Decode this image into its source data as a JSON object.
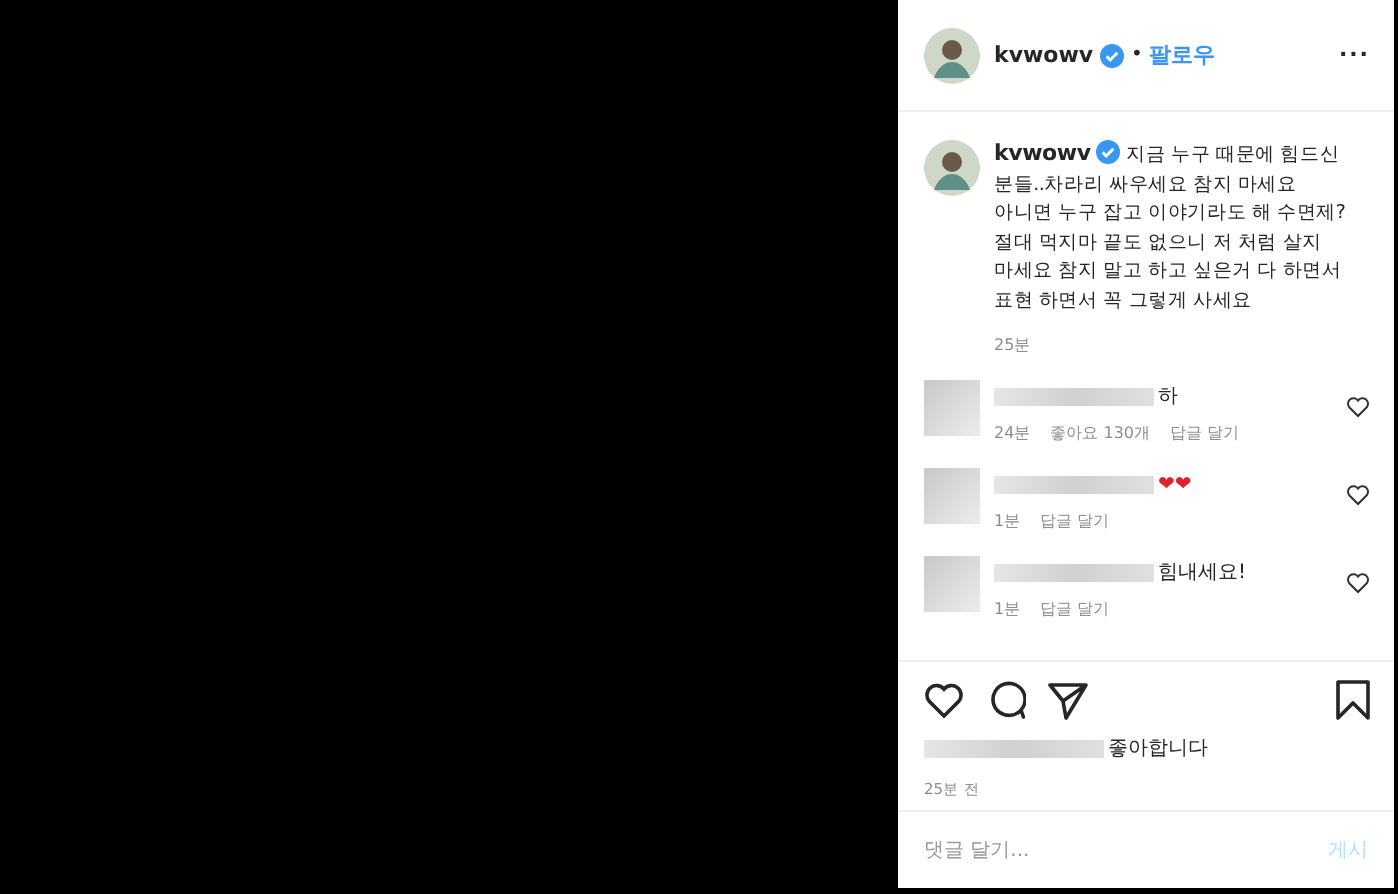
{
  "header": {
    "username": "kvwowv",
    "separator": "•",
    "follow": "팔로우",
    "more": "..."
  },
  "post": {
    "username": "kvwowv",
    "caption": "지금 누구 때문에 힘드신 분들..차라리 싸우세요 참지 마세요 아니면 누구 잡고 이야기라도 해 수면제? 절대 먹지마 끝도 없으니 저 처럼 살지 마세요 참지 말고 하고 싶은거 다 하면서 표현 하면서 꼭 그렇게 사세요",
    "time": "25분"
  },
  "comments": [
    {
      "text": "하",
      "time": "24분",
      "likes": "좋아요 130개",
      "reply": "답글 달기",
      "liked": false
    },
    {
      "text": "❤❤",
      "time": "1분",
      "reply": "답글 달기",
      "liked": false
    },
    {
      "text": "힘내세요!",
      "time": "1분",
      "reply": "답글 달기",
      "liked": false
    }
  ],
  "actions": {
    "liked": false,
    "saved": false
  },
  "likes_text": "좋아합니다",
  "post_time": "25분 전",
  "comment_box": {
    "placeholder": "댓글 달기...",
    "submit": "게시"
  }
}
